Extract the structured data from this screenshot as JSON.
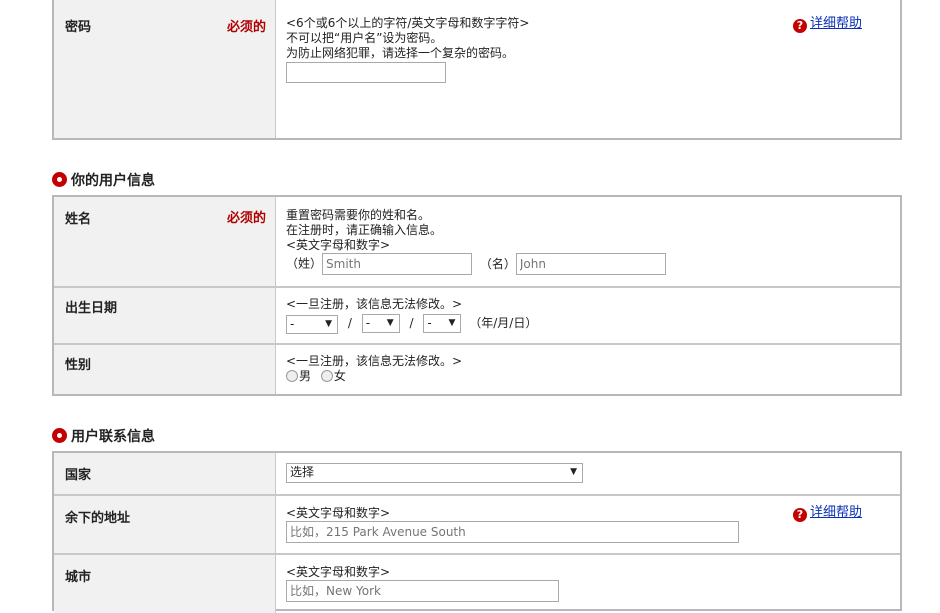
{
  "password": {
    "label": "密码",
    "required": "必须的",
    "hint1": "<6个或6个以上的字符/英文字母和数字字符>",
    "hint2": "不可以把“用户名”设为密码。",
    "hint3": "为防止网络犯罪，请选择一个复杂的密码。",
    "help": "详细帮助"
  },
  "user_info": {
    "heading": "你的用户信息",
    "name": {
      "label": "姓名",
      "required": "必须的",
      "hint1": "重置密码需要你的姓和名。",
      "hint2": "在注册时，请正确输入信息。",
      "hint3": "<英文字母和数字>",
      "last_label": "（姓）",
      "last_placeholder": "Smith",
      "first_label": "（名）",
      "first_placeholder": "John"
    },
    "dob": {
      "label": "出生日期",
      "hint": "<一旦注册，该信息无法修改。>",
      "year": "-",
      "month": "-",
      "day": "-",
      "sep": "/",
      "format": "（年/月/日）"
    },
    "gender": {
      "label": "性别",
      "hint": "<一旦注册，该信息无法修改。>",
      "male": "男",
      "female": "女"
    }
  },
  "contact": {
    "heading": "用户联系信息",
    "country": {
      "label": "国家",
      "selected": "选择"
    },
    "address": {
      "label": "余下的地址",
      "hint": "<英文字母和数字>",
      "placeholder": "比如，215 Park Avenue South",
      "help": "详细帮助"
    },
    "city": {
      "label": "城市",
      "hint": "<英文字母和数字>",
      "placeholder": "比如，New York"
    }
  }
}
